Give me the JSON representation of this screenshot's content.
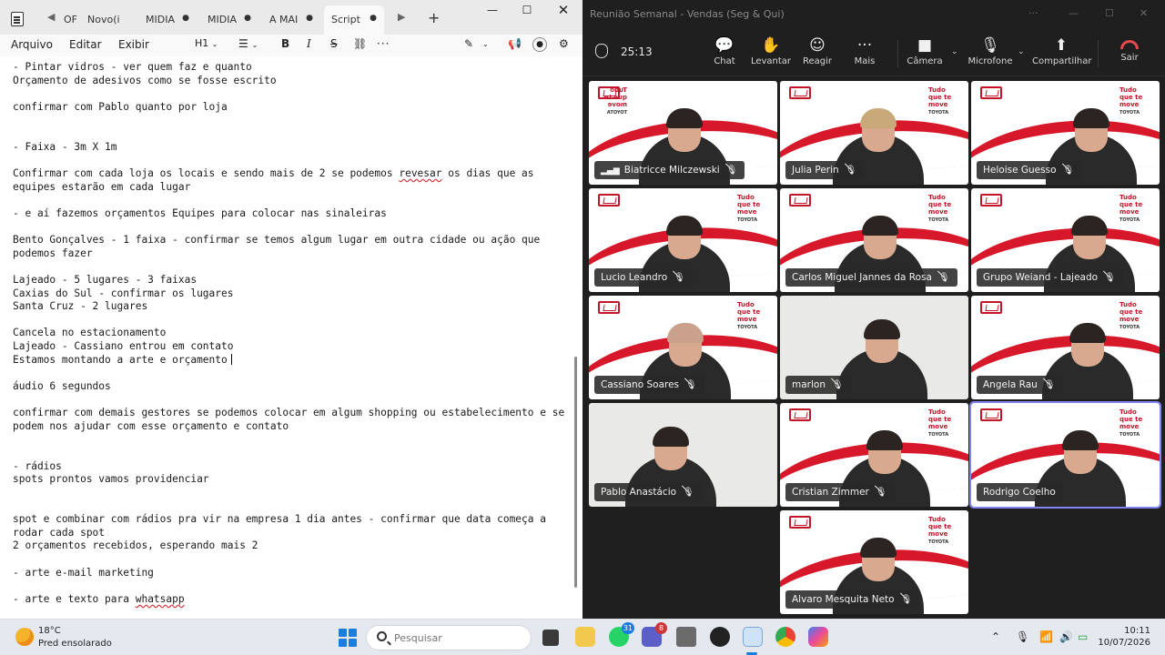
{
  "notepad": {
    "tabs": [
      "OF",
      "Novo(i",
      "MIDIA",
      "MIDIA",
      "A MAI",
      "Script"
    ],
    "active_tab": "Script",
    "menu": {
      "file": "Arquivo",
      "edit": "Editar",
      "view": "Exibir"
    },
    "format": {
      "heading": "H1",
      "bold": "B",
      "italic": "I",
      "strike": "S",
      "more": "···"
    },
    "lines": [
      "- Pintar vidros - ver quem faz e quanto",
      "Orçamento de adesivos como se fosse escrito",
      "",
      "confirmar com Pablo quanto por loja",
      "",
      "",
      "- Faixa - 3m X 1m",
      "",
      "Confirmar com cada loja os locais e sendo mais de 2 se podemos revesar os dias que as",
      "equipes estarão em cada lugar",
      "",
      "- e aí fazemos orçamentos Equipes para colocar nas sinaleiras",
      "",
      "Bento Gonçalves - 1 faixa - confirmar se temos algum lugar em outra cidade ou ação que",
      "podemos fazer",
      "",
      "Lajeado - 5 lugares - 3 faixas",
      "Caxias do Sul - confirmar os lugares",
      "Santa Cruz - 2 lugares",
      "",
      "Cancela no estacionamento",
      "Lajeado - Cassiano entrou em contato",
      "Estamos montando a arte e orçamento",
      "",
      "áudio 6 segundos",
      "",
      "confirmar com demais gestores se podemos colocar em algum shopping ou estabelecimento e se",
      "podem nos ajudar com esse orçamento e contato",
      "",
      "",
      "- rádios",
      "spots prontos vamos providenciar",
      "",
      "",
      "spot e combinar com rádios pra vir na empresa 1 dia antes - confirmar que data começa a",
      "rodar cada spot",
      "2 orçamentos recebidos, esperando mais 2",
      "",
      "- arte e-mail marketing",
      "",
      "- arte e texto para whatsapp"
    ],
    "misspelled": [
      "revesar",
      "whatsapp"
    ]
  },
  "teams": {
    "window_title": "Reunião Semanal - Vendas (Seg & Qui)",
    "timer": "25:13",
    "toolbar": {
      "chat": "Chat",
      "raise": "Levantar",
      "react": "Reagir",
      "more": "Mais",
      "camera": "Câmera",
      "mic": "Microfone",
      "share": "Compartilhar",
      "leave": "Sair"
    },
    "brand_tagline": "Tudo que te move",
    "brand_name": "TOYOTA",
    "participants": [
      {
        "name": "Biatricce Milczewski",
        "muted": true
      },
      {
        "name": "Julia Perin",
        "muted": true
      },
      {
        "name": "Heloise Guesso",
        "muted": true
      },
      {
        "name": "Lucio Leandro",
        "muted": true
      },
      {
        "name": "Carlos Miguel Jannes da Rosa",
        "muted": true
      },
      {
        "name": "Grupo Weiand - Lajeado",
        "muted": true
      },
      {
        "name": "Cassiano Soares",
        "muted": true
      },
      {
        "name": "marlon",
        "muted": true
      },
      {
        "name": "Angela Rau",
        "muted": true
      },
      {
        "name": "Pablo Anastácio",
        "muted": true
      },
      {
        "name": "Cristian Zimmer",
        "muted": true
      },
      {
        "name": "Rodrigo Coelho",
        "muted": false,
        "speaking": true
      },
      {
        "name": "Alvaro Mesquita Neto",
        "muted": true
      }
    ],
    "accent_color": "#7f85f5",
    "brand_red": "#d6182a"
  },
  "taskbar": {
    "weather_temp": "18°C",
    "weather_desc": "Pred ensolarado",
    "search_placeholder": "Pesquisar",
    "badges": {
      "whatsapp": "31",
      "teams": "8"
    },
    "time": "10:11",
    "date": "10/07/2026"
  }
}
